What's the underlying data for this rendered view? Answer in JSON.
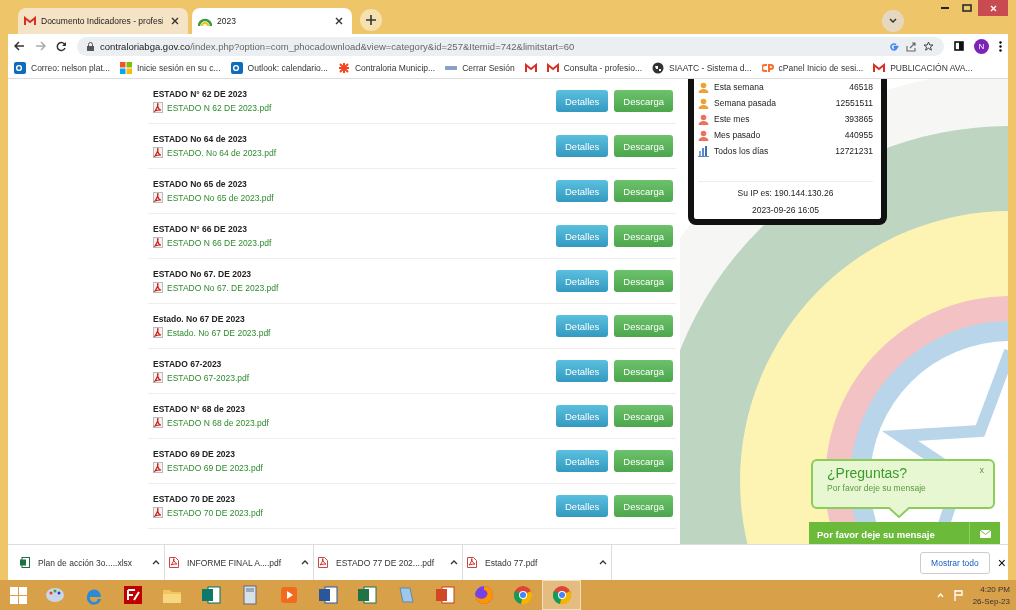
{
  "tabs": [
    {
      "kind": "mail",
      "title": "Documento Indicadores - profesi",
      "selected": false
    },
    {
      "kind": "site",
      "title": "2023",
      "selected": true
    }
  ],
  "address": {
    "host": "contraloriabga.gov.co",
    "path": "/index.php?option=com_phocadownload&view=category&id=257&Itemid=742&limitstart=60"
  },
  "profile": {
    "initial": "N"
  },
  "bookmarks": [
    {
      "kind": "outlook",
      "label": "Correo: nelson plat..."
    },
    {
      "kind": "windows",
      "label": "Inicie sesión en su c..."
    },
    {
      "kind": "outlook",
      "label": "Outlook: calendario..."
    },
    {
      "kind": "joomla",
      "label": "Contraloria Municip..."
    },
    {
      "kind": "sis",
      "label": "Cerrar Sesión"
    },
    {
      "kind": "mail"
    },
    {
      "kind": "mail",
      "label": "Consulta - profesio..."
    },
    {
      "kind": "globe",
      "label": "SIAATC - Sistema d..."
    },
    {
      "kind": "cpanel",
      "label": "cPanel Inicio de sesi..."
    },
    {
      "kind": "mail",
      "label": "PUBLICACIÓN AVA..."
    }
  ],
  "documents": [
    {
      "title": "ESTADO N° 62 DE 2023",
      "file": "ESTADO N 62 DE 2023.pdf",
      "details": "Detalles",
      "download": "Descarga"
    },
    {
      "title": "ESTADO No 64 de 2023",
      "file": "ESTADO. No 64 de 2023.pdf",
      "details": "Detalles",
      "download": "Descarga"
    },
    {
      "title": "ESTADO No 65 de 2023",
      "file": "ESTADO No 65 de 2023.pdf",
      "details": "Detalles",
      "download": "Descarga"
    },
    {
      "title": "ESTADO N° 66 DE 2023",
      "file": "ESTADO N 66 DE 2023.pdf",
      "details": "Detalles",
      "download": "Descarga"
    },
    {
      "title": "ESTADO No 67. DE 2023",
      "file": "ESTADO No 67. DE 2023.pdf",
      "details": "Detalles",
      "download": "Descarga"
    },
    {
      "title": "Estado. No 67 DE 2023",
      "file": "Estado. No 67 DE 2023.pdf",
      "details": "Detalles",
      "download": "Descarga"
    },
    {
      "title": "ESTADO 67-2023",
      "file": "ESTADO 67-2023.pdf",
      "details": "Detalles",
      "download": "Descarga"
    },
    {
      "title": "ESTADO N° 68 de 2023",
      "file": "ESTADO N 68 de 2023.pdf",
      "details": "Detalles",
      "download": "Descarga"
    },
    {
      "title": "ESTADO 69 DE 2023",
      "file": "ESTADO 69 DE 2023.pdf",
      "details": "Detalles",
      "download": "Descarga"
    },
    {
      "title": "ESTADO 70 DE 2023",
      "file": "ESTADO 70 DE 2023.pdf",
      "details": "Detalles",
      "download": "Descarga"
    }
  ],
  "visitor_stats": {
    "rows": [
      {
        "kind": "week",
        "label": "Esta semana",
        "value": "46518"
      },
      {
        "kind": "week",
        "label": "Semana pasada",
        "value": "12551511"
      },
      {
        "kind": "month",
        "label": "Este mes",
        "value": "393865"
      },
      {
        "kind": "month",
        "label": "Mes pasado",
        "value": "440955"
      },
      {
        "kind": "total",
        "label": "Todos los días",
        "value": "12721231"
      }
    ],
    "ip": "Su IP es: 190.144.130.26",
    "datetime": "2023-09-26 16:05"
  },
  "chat": {
    "title": "¿Preguntas?",
    "subtitle": "Por favor deje su mensaje",
    "close": "x",
    "bar": "Por favor deje su mensaje"
  },
  "downloads": {
    "items": [
      {
        "kind": "xlsx",
        "name": "Plan de acción 3o.....xlsx"
      },
      {
        "kind": "pdf",
        "name": "INFORME FINAL A....pdf"
      },
      {
        "kind": "pdf",
        "name": "ESTADO 77 DE 202....pdf"
      },
      {
        "kind": "pdf",
        "name": "Estado 77.pdf"
      }
    ],
    "show_all": "Mostrar todo",
    "close": "×"
  },
  "taskbar": {
    "apps": [
      {
        "kind": "paint",
        "selected": false
      },
      {
        "kind": "ie",
        "selected": false
      },
      {
        "kind": "ftp",
        "selected": false
      },
      {
        "kind": "folder",
        "selected": false
      },
      {
        "kind": "publisher",
        "selected": false
      },
      {
        "kind": "calculator",
        "selected": false
      },
      {
        "kind": "media",
        "selected": false
      },
      {
        "kind": "word",
        "selected": false
      },
      {
        "kind": "excel",
        "selected": false
      },
      {
        "kind": "notepad",
        "selected": false
      },
      {
        "kind": "powerpoint",
        "selected": false
      },
      {
        "kind": "firefox",
        "selected": false
      },
      {
        "kind": "chrome",
        "selected": false
      },
      {
        "kind": "chrome",
        "selected": true
      }
    ],
    "time": "4:20 PM",
    "date": "26-Sep-23"
  }
}
